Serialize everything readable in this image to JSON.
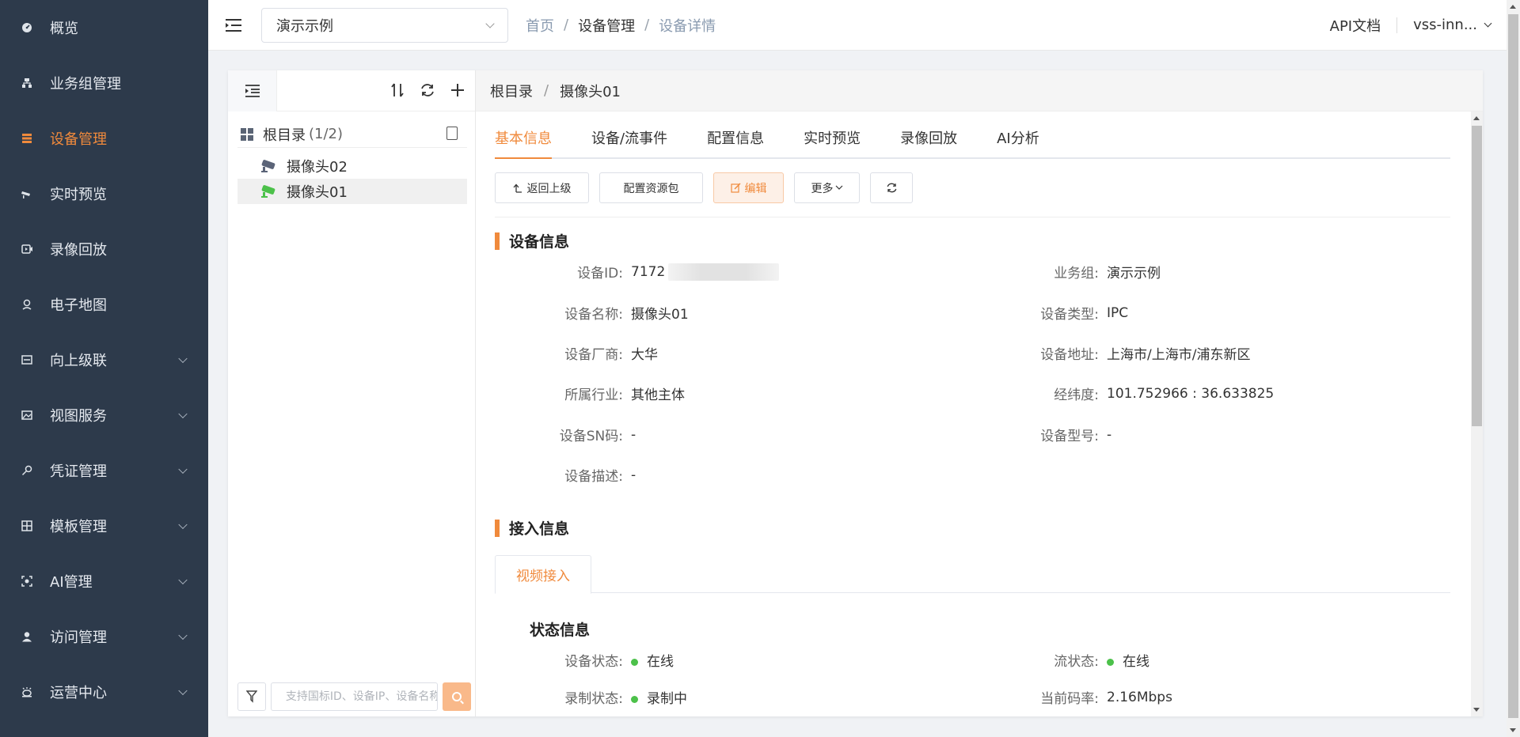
{
  "sidebar": {
    "items": [
      {
        "label": "概览",
        "icon": "dashboard-icon"
      },
      {
        "label": "业务组管理",
        "icon": "org-icon"
      },
      {
        "label": "设备管理",
        "icon": "device-list-icon",
        "active": true
      },
      {
        "label": "实时预览",
        "icon": "camera-icon"
      },
      {
        "label": "录像回放",
        "icon": "playback-icon"
      },
      {
        "label": "电子地图",
        "icon": "map-pin-icon"
      },
      {
        "label": "向上级联",
        "icon": "cascade-icon",
        "expandable": true
      },
      {
        "label": "视图服务",
        "icon": "image-icon",
        "expandable": true
      },
      {
        "label": "凭证管理",
        "icon": "key-icon",
        "expandable": true
      },
      {
        "label": "模板管理",
        "icon": "template-grid-icon",
        "expandable": true
      },
      {
        "label": "AI管理",
        "icon": "ai-scan-icon",
        "expandable": true
      },
      {
        "label": "访问管理",
        "icon": "user-icon",
        "expandable": true
      },
      {
        "label": "运营中心",
        "icon": "alarm-icon",
        "expandable": true
      }
    ]
  },
  "header": {
    "workspace": "演示示例",
    "breadcrumb": [
      "首页",
      "设备管理",
      "设备详情"
    ],
    "api_doc": "API文档",
    "user": "vss-inn..."
  },
  "tree": {
    "root_label": "根目录",
    "root_count": "(1/2)",
    "nodes": [
      {
        "label": "摄像头02",
        "status": "offline"
      },
      {
        "label": "摄像头01",
        "status": "online",
        "selected": true
      }
    ],
    "search_placeholder": "支持国标ID、设备IP、设备名称"
  },
  "detail": {
    "breadcrumb": [
      "根目录",
      "摄像头01"
    ],
    "tabs": [
      "基本信息",
      "设备/流事件",
      "配置信息",
      "实时预览",
      "录像回放",
      "AI分析"
    ],
    "active_tab": "基本信息",
    "actions": {
      "back": "返回上级",
      "config_pkg": "配置资源包",
      "edit": "编辑",
      "more": "更多"
    },
    "device_info_title": "设备信息",
    "device_info": {
      "id_label": "设备ID:",
      "id_value": "7172",
      "group_label": "业务组:",
      "group_value": "演示示例",
      "name_label": "设备名称:",
      "name_value": "摄像头01",
      "type_label": "设备类型:",
      "type_value": "IPC",
      "vendor_label": "设备厂商:",
      "vendor_value": "大华",
      "address_label": "设备地址:",
      "address_value": "上海市/上海市/浦东新区",
      "industry_label": "所属行业:",
      "industry_value": "其他主体",
      "coords_label": "经纬度:",
      "coords_value": "101.752966 : 36.633825",
      "sn_label": "设备SN码:",
      "sn_value": "-",
      "model_label": "设备型号:",
      "model_value": "-",
      "desc_label": "设备描述:",
      "desc_value": "-"
    },
    "access_info_title": "接入信息",
    "access_subtab": "视频接入",
    "status_title": "状态信息",
    "status": {
      "device_label": "设备状态:",
      "device_value": "在线",
      "stream_label": "流状态:",
      "stream_value": "在线",
      "record_label": "录制状态:",
      "record_value": "录制中",
      "bitrate_label": "当前码率:",
      "bitrate_value": "2.16Mbps"
    }
  },
  "colors": {
    "sidebar_bg": "#2d3a4b",
    "accent": "#f08a3c",
    "online": "#4cc14a"
  }
}
